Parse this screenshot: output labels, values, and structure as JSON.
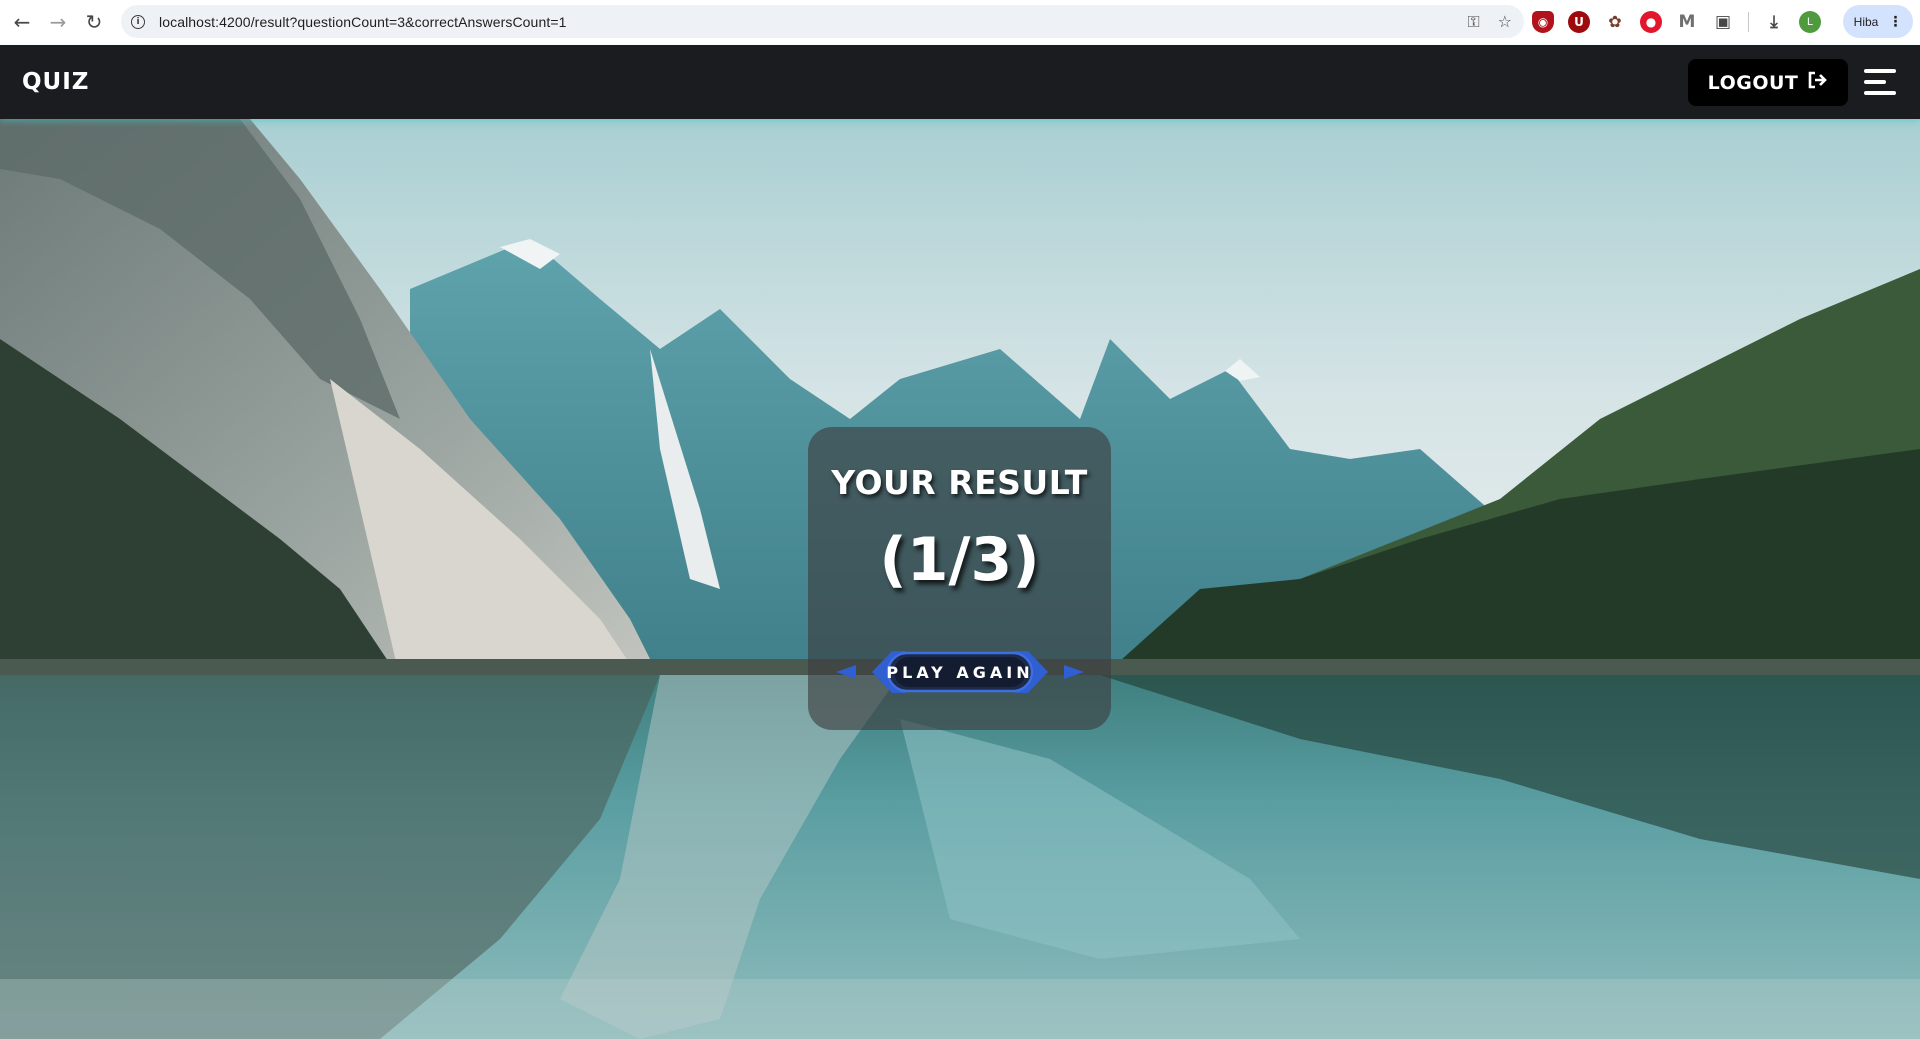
{
  "browser": {
    "url": "localhost:4200/result?questionCount=3&correctAnswersCount=1",
    "profile_initial": "L",
    "profile_name": "Hiba"
  },
  "header": {
    "brand": "QUIZ",
    "logout_label": "LOGOUT"
  },
  "result": {
    "title": "YOUR RESULT",
    "score": "(1/3)",
    "play_again_label": "PLAY AGAIN"
  },
  "colors": {
    "header_bg": "#1a1c1f",
    "logout_bg": "#000000",
    "button_accent": "#2f5fd0",
    "card_bg": "rgba(60,60,62,0.62)"
  }
}
